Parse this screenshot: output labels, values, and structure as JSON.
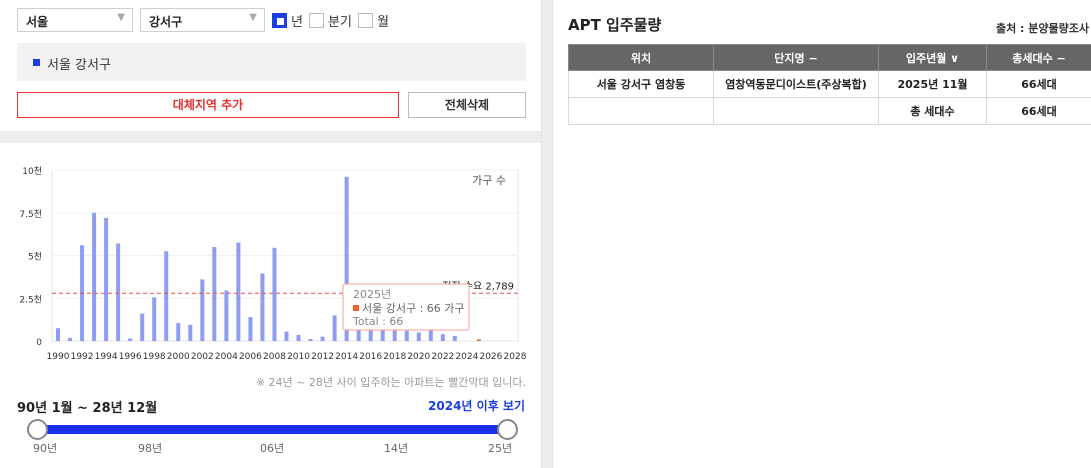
{
  "filters": {
    "sido": "서울",
    "gu": "강서구",
    "period_options": [
      {
        "label": "년",
        "checked": true
      },
      {
        "label": "분기",
        "checked": false
      },
      {
        "label": "월",
        "checked": false
      }
    ]
  },
  "region": {
    "label": "서울 강서구",
    "marker_color": "#1b3fe0"
  },
  "buttons": {
    "add_region": "대체지역 추가",
    "delete_all": "전체삭제"
  },
  "chart_data": {
    "type": "bar",
    "legend_label": "가구 수",
    "y_tick_labels": [
      "0",
      "2.5천",
      "5천",
      "7.5천",
      "10천"
    ],
    "ylim": [
      0,
      10000
    ],
    "x_tick_labels": [
      "1990",
      "1992",
      "1994",
      "1996",
      "1998",
      "2000",
      "2002",
      "2004",
      "2006",
      "2008",
      "2010",
      "2012",
      "2014",
      "2016",
      "2018",
      "2020",
      "2022",
      "2024",
      "2026",
      "2028"
    ],
    "categories": [
      "1990",
      "1991",
      "1992",
      "1993",
      "1994",
      "1995",
      "1996",
      "1997",
      "1998",
      "1999",
      "2000",
      "2001",
      "2002",
      "2003",
      "2004",
      "2005",
      "2006",
      "2007",
      "2008",
      "2009",
      "2010",
      "2011",
      "2012",
      "2013",
      "2014",
      "2015",
      "2016",
      "2017",
      "2018",
      "2019",
      "2020",
      "2021",
      "2022",
      "2023",
      "2024",
      "2025",
      "2026",
      "2027",
      "2028"
    ],
    "values": [
      750,
      180,
      5600,
      7500,
      7200,
      5700,
      150,
      1600,
      2550,
      5250,
      1050,
      950,
      3600,
      5500,
      2950,
      5750,
      1400,
      3950,
      5450,
      550,
      350,
      120,
      250,
      1500,
      9600,
      1800,
      1500,
      800,
      700,
      600,
      500,
      900,
      400,
      300,
      0,
      66,
      0,
      0,
      0
    ],
    "highlight_categories": [
      "2025",
      "2026",
      "2027",
      "2028"
    ],
    "bar_color": "#8f9cf0",
    "highlight_color": "#f0602a",
    "reference_line": {
      "label": "적정 수요 2,789",
      "value": 2789,
      "color": "#e65050"
    },
    "tooltip": {
      "title": "2025년",
      "series_line": "서울 강서구 : 66 가구",
      "total_line": "Total : 66"
    }
  },
  "chart_note": "※ 24년 ~ 28년 사이 입주하는 아파트는 빨간막대 입니다.",
  "range": {
    "title": "90년 1월 ~ 28년 12월",
    "link": "2024년 이후 보기",
    "ticks": [
      "90년",
      "98년",
      "06년",
      "14년",
      "25년"
    ]
  },
  "table": {
    "title": "APT 입주물량",
    "source": "출처 : 분양물량조사",
    "headers": [
      "위치",
      "단지명 −",
      "입주년월 ∨",
      "총세대수 −"
    ],
    "rows": [
      {
        "location": "서울 강서구 염창동",
        "complex": "염창역동문디이스트(주상복합)",
        "date": "2025년 11월",
        "units": "66세대"
      }
    ],
    "total": {
      "label": "총 세대수",
      "value": "66세대"
    }
  }
}
